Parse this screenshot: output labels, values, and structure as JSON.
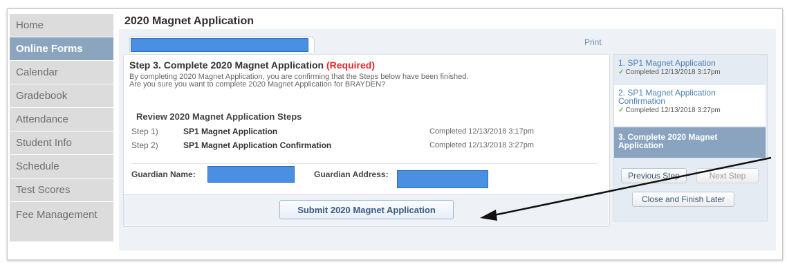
{
  "page": {
    "title": "2020 Magnet Application",
    "print_label": "Print"
  },
  "sidebar": {
    "items": [
      {
        "label": "Home"
      },
      {
        "label": "Online Forms"
      },
      {
        "label": "Calendar"
      },
      {
        "label": "Gradebook"
      },
      {
        "label": "Attendance"
      },
      {
        "label": "Student Info"
      },
      {
        "label": "Schedule"
      },
      {
        "label": "Test Scores"
      },
      {
        "label": "Fee Management"
      }
    ]
  },
  "step": {
    "title": "Step 3. Complete 2020 Magnet Application",
    "required": "(Required)",
    "desc1": "By completing 2020 Magnet Application, you are confirming that the Steps below have been finished.",
    "desc2": "Are you sure you want to complete 2020 Magnet Application for BRAYDEN?"
  },
  "review": {
    "title": "Review 2020 Magnet Application Steps",
    "steps": [
      {
        "label": "Step 1)",
        "name": "SP1 Magnet Application",
        "status": "Completed 12/13/2018 3:17pm"
      },
      {
        "label": "Step 2)",
        "name": "SP1 Magnet Application Confirmation",
        "status": "Completed 12/13/2018 3:27pm"
      }
    ]
  },
  "guardian": {
    "name_label": "Guardian Name:",
    "address_label": "Guardian Address:"
  },
  "submit_label": "Submit 2020 Magnet Application",
  "side_steps": [
    {
      "title": "1. SP1 Magnet Application",
      "completed": "Completed 12/13/2018 3:17pm"
    },
    {
      "title": "2. SP1 Magnet Application Confirmation",
      "completed": "Completed 12/13/2018 3:27pm"
    },
    {
      "title": "3. Complete 2020 Magnet Application"
    }
  ],
  "buttons": {
    "previous": "Previous Step",
    "next": "Next Step",
    "close": "Close and Finish Later"
  },
  "colors": {
    "accent": "#8ba5bf",
    "required": "#e8262c",
    "redaction": "#4a90e2"
  }
}
